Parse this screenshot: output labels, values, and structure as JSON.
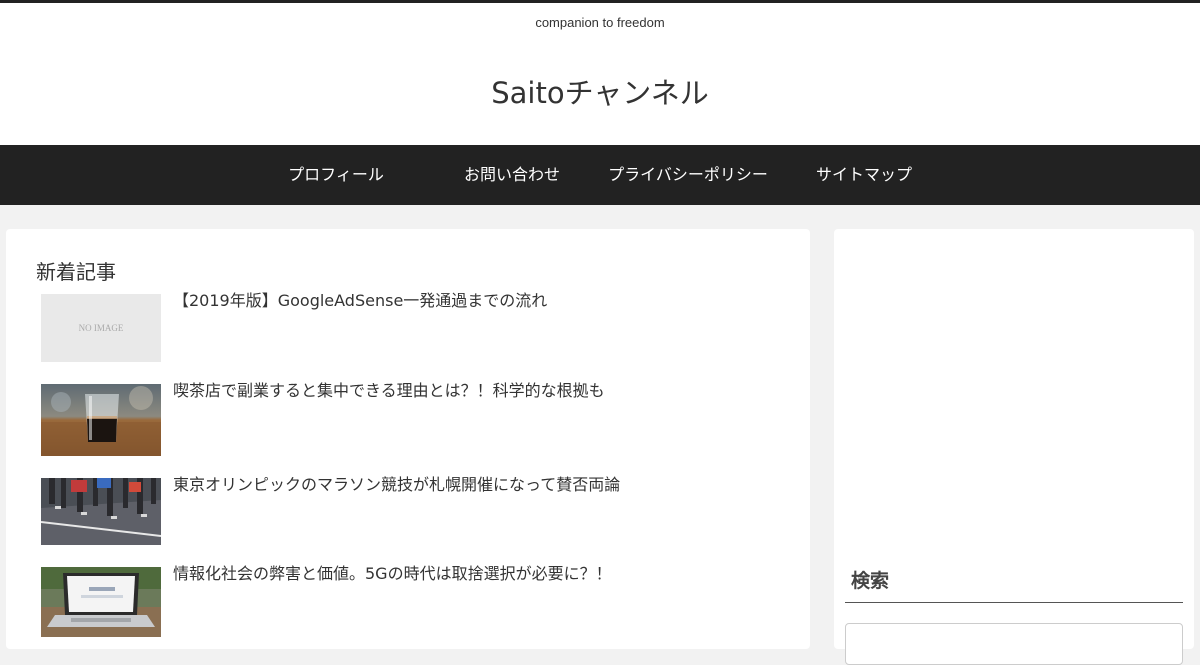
{
  "header": {
    "tagline": "companion to freedom",
    "site_title": "Saitoチャンネル"
  },
  "nav": {
    "items": [
      {
        "label": "プロフィール"
      },
      {
        "label": "お問い合わせ"
      },
      {
        "label": "プライバシーポリシー"
      },
      {
        "label": "サイトマップ"
      }
    ]
  },
  "main": {
    "section_title": "新着記事",
    "articles": [
      {
        "title": "【2019年版】GoogleAdSense一発通過までの流れ",
        "thumb_text": "NO IMAGE"
      },
      {
        "title": "喫茶店で副業すると集中できる理由とは？！科学的な根拠も"
      },
      {
        "title": "東京オリンピックのマラソン競技が札幌開催になって賛否両論"
      },
      {
        "title": "情報化社会の弊害と価値。5Gの時代は取捨選択が必要に？！"
      }
    ]
  },
  "sidebar": {
    "widget_title": "検索"
  },
  "colors": {
    "nav_bg": "#222222",
    "page_bg": "#f2f2f2",
    "text": "#333333"
  }
}
